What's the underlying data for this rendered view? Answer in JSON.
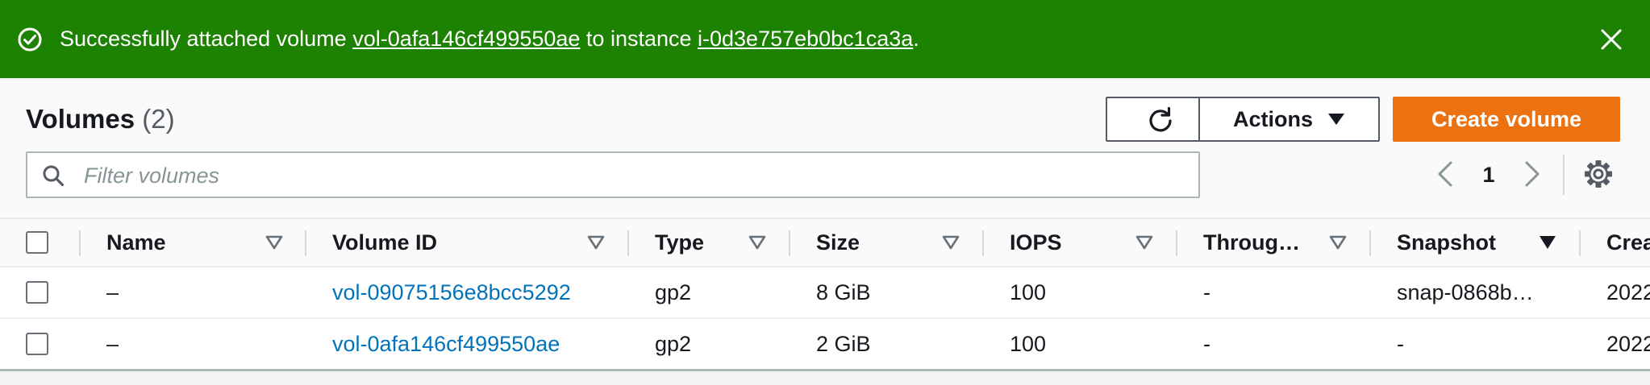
{
  "flash": {
    "prefix": "Successfully attached volume ",
    "volume_link": "vol-0afa146cf499550ae",
    "middle": " to instance ",
    "instance_link": "i-0d3e757eb0bc1ca3a",
    "suffix": ".",
    "color": "#1d8102"
  },
  "header": {
    "title": "Volumes",
    "count": "(2)",
    "actions_label": "Actions",
    "create_label": "Create volume",
    "create_color": "#ec7211"
  },
  "search": {
    "placeholder": "Filter volumes"
  },
  "pagination": {
    "current_page": "1"
  },
  "table": {
    "columns": [
      "Name",
      "Volume ID",
      "Type",
      "Size",
      "IOPS",
      "Throug…",
      "Snapshot",
      "Crea"
    ],
    "rows": [
      {
        "name": "–",
        "volume_id": "vol-09075156e8bcc5292",
        "type": "gp2",
        "size": "8 GiB",
        "iops": "100",
        "throughput": "-",
        "snapshot": "snap-0868b…",
        "created": "2022"
      },
      {
        "name": "–",
        "volume_id": "vol-0afa146cf499550ae",
        "type": "gp2",
        "size": "2 GiB",
        "iops": "100",
        "throughput": "-",
        "snapshot": "-",
        "created": "2022"
      }
    ]
  },
  "icons": {
    "success": "check-circle-icon",
    "close": "close-icon",
    "refresh": "refresh-icon",
    "dropdown": "caret-down-icon",
    "search": "search-icon",
    "prev": "chevron-left-icon",
    "next": "chevron-right-icon",
    "settings": "gear-icon",
    "sort": "sort-caret-icon"
  }
}
